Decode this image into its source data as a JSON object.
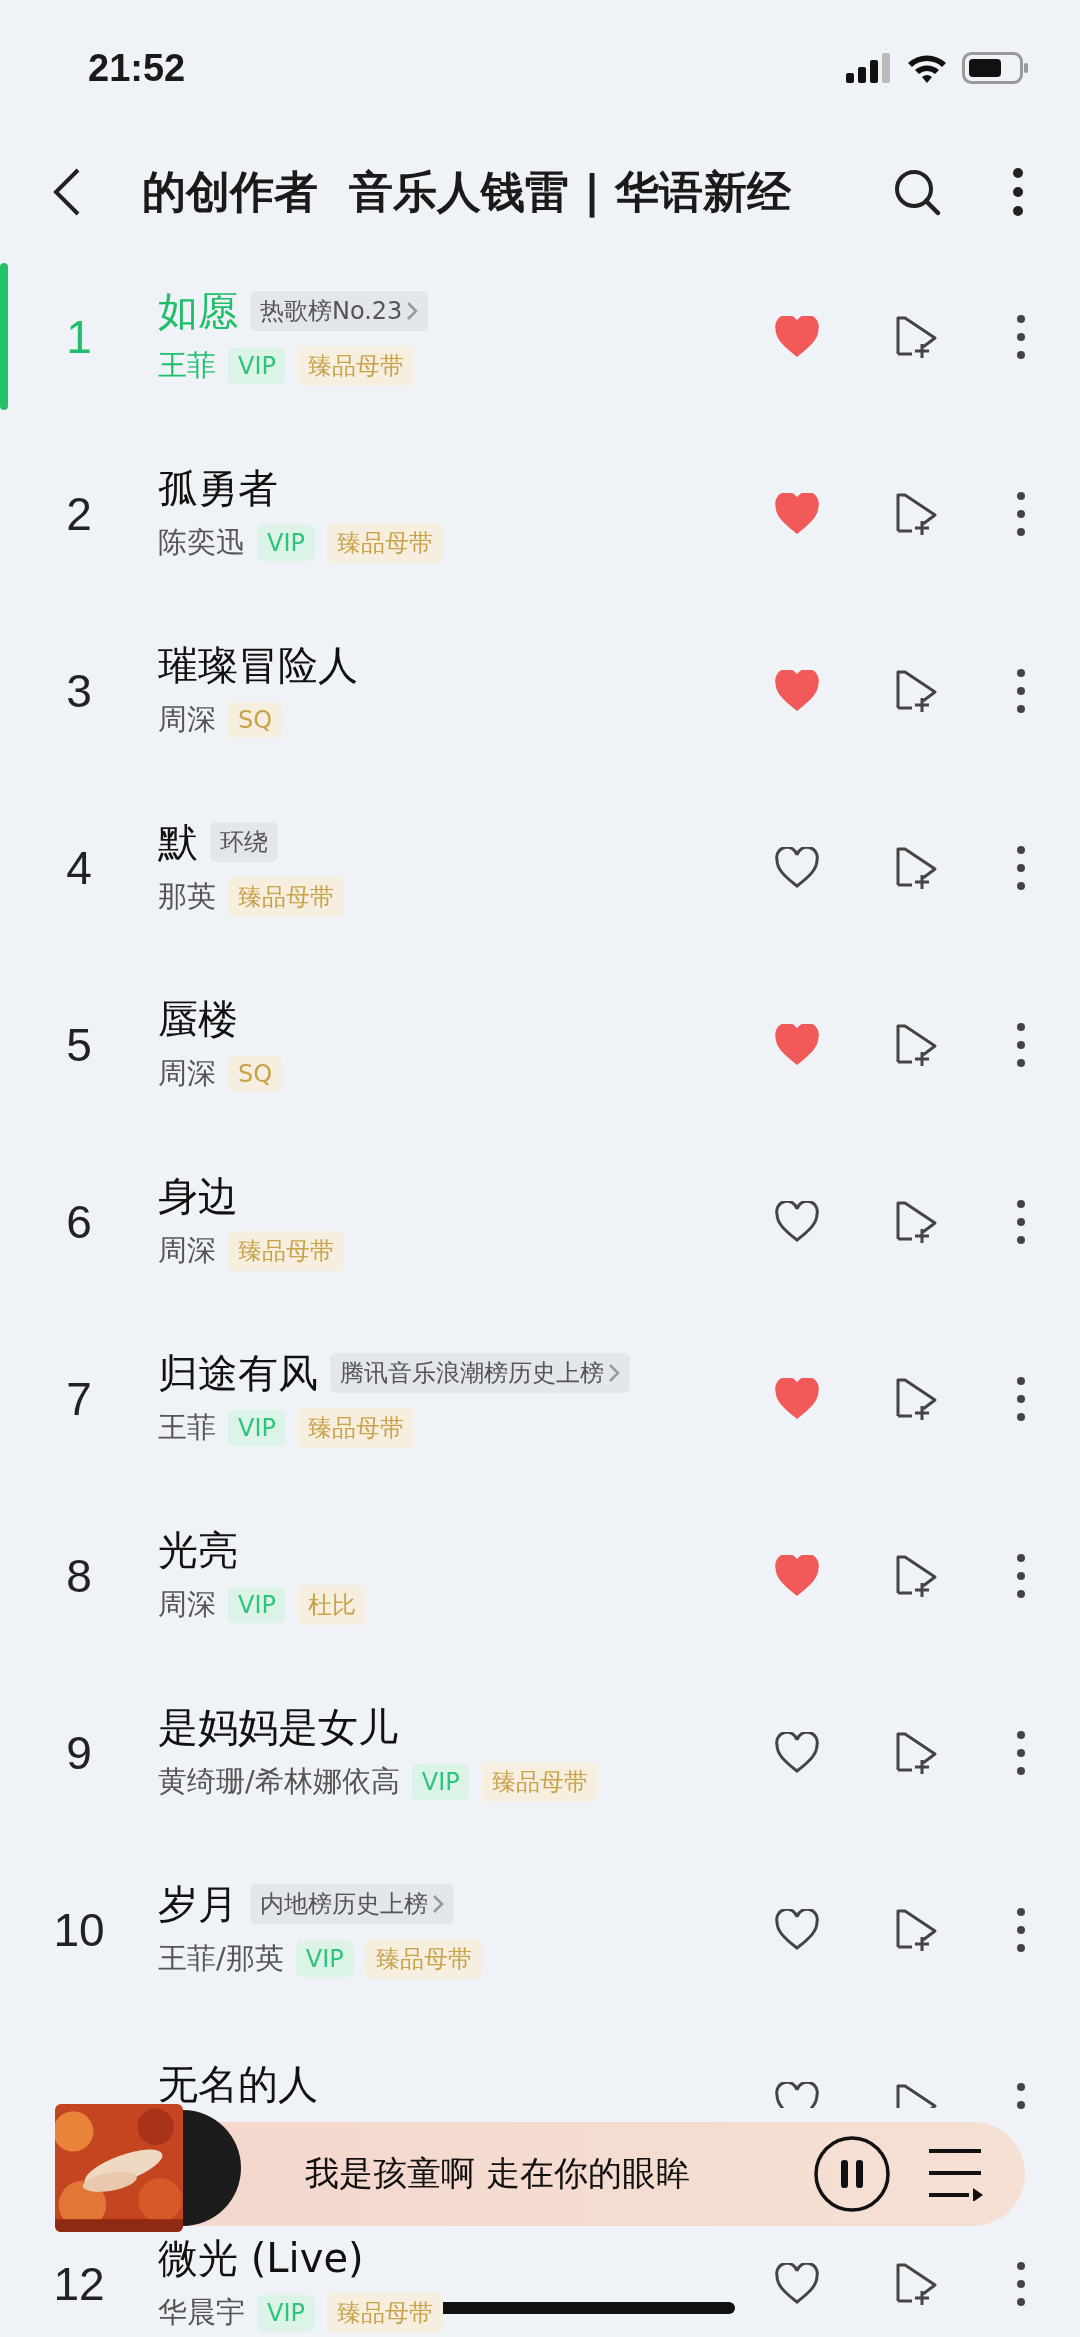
{
  "status_bar": {
    "time": "21:52"
  },
  "header": {
    "title": "的创作者  音乐人钱雷 | 华语新经"
  },
  "songs": [
    {
      "number": "1",
      "title": "如愿",
      "selected": true,
      "liked": true,
      "artist": "王菲",
      "tags": [
        {
          "kind": "chart",
          "text": "热歌榜No.23"
        },
        {
          "kind": "vip",
          "text": "VIP"
        },
        {
          "kind": "gold",
          "text": "臻品母带"
        }
      ]
    },
    {
      "number": "2",
      "title": "孤勇者",
      "selected": false,
      "liked": true,
      "artist": "陈奕迅",
      "tags": [
        {
          "kind": "vip",
          "text": "VIP"
        },
        {
          "kind": "gold",
          "text": "臻品母带"
        }
      ]
    },
    {
      "number": "3",
      "title": "璀璨冒险人",
      "selected": false,
      "liked": true,
      "artist": "周深",
      "tags": [
        {
          "kind": "gold",
          "text": "SQ"
        }
      ]
    },
    {
      "number": "4",
      "title": "默",
      "selected": false,
      "liked": false,
      "artist": "那英",
      "tags": [
        {
          "kind": "grey",
          "text": "环绕"
        },
        {
          "kind": "gold",
          "text": "臻品母带"
        }
      ]
    },
    {
      "number": "5",
      "title": "蜃楼",
      "selected": false,
      "liked": true,
      "artist": "周深",
      "tags": [
        {
          "kind": "gold",
          "text": "SQ"
        }
      ]
    },
    {
      "number": "6",
      "title": "身边",
      "selected": false,
      "liked": false,
      "artist": "周深",
      "tags": [
        {
          "kind": "gold",
          "text": "臻品母带"
        }
      ]
    },
    {
      "number": "7",
      "title": "归途有风",
      "selected": false,
      "liked": true,
      "artist": "王菲",
      "tags": [
        {
          "kind": "chart",
          "text": "腾讯音乐浪潮榜历史上榜"
        },
        {
          "kind": "vip",
          "text": "VIP"
        },
        {
          "kind": "gold",
          "text": "臻品母带"
        }
      ]
    },
    {
      "number": "8",
      "title": "光亮",
      "selected": false,
      "liked": true,
      "artist": "周深",
      "tags": [
        {
          "kind": "vip",
          "text": "VIP"
        },
        {
          "kind": "gold",
          "text": "杜比"
        }
      ]
    },
    {
      "number": "9",
      "title": "是妈妈是女儿",
      "selected": false,
      "liked": false,
      "artist": "黄绮珊/希林娜依高",
      "tags": [
        {
          "kind": "vip",
          "text": "VIP"
        },
        {
          "kind": "gold",
          "text": "臻品母带"
        }
      ]
    },
    {
      "number": "10",
      "title": "岁月",
      "selected": false,
      "liked": false,
      "artist": "王菲/那英",
      "tags": [
        {
          "kind": "chart",
          "text": "内地榜历史上榜"
        },
        {
          "kind": "vip",
          "text": "VIP"
        },
        {
          "kind": "gold",
          "text": "臻品母带"
        }
      ]
    },
    {
      "title": "无名的人",
      "selected": false,
      "liked": false
    },
    {
      "number": "12",
      "title": "微光 (Live)",
      "selected": false,
      "liked": false,
      "artist": "华晨宇",
      "tags": [
        {
          "kind": "vip",
          "text": "VIP"
        },
        {
          "kind": "gold",
          "text": "臻品母带"
        }
      ]
    }
  ],
  "player": {
    "lyric": "我是孩童啊 走在你的眼眸",
    "playing": true
  }
}
